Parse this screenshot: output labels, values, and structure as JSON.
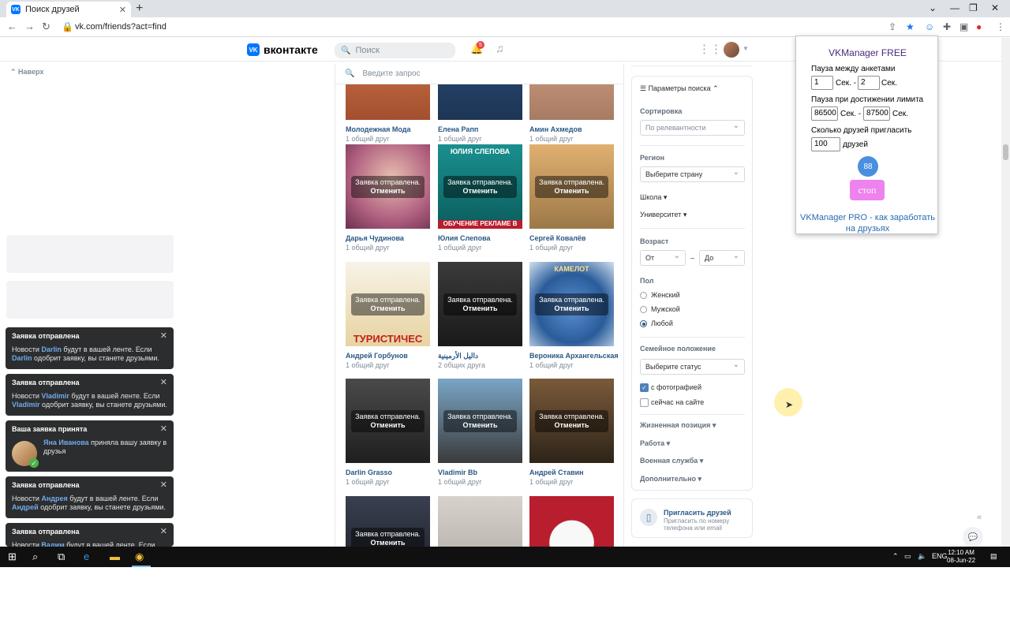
{
  "browser": {
    "tab_title": "Поиск друзей",
    "tab_favicon": "VK",
    "url": "vk.com/friends?act=find",
    "new_tab": "+",
    "back": "←",
    "forward": "→",
    "reload": "↻",
    "win_minimize": "⌄",
    "win_min": "—",
    "win_max": "❐",
    "win_close": "✕"
  },
  "header": {
    "logo_badge": "VK",
    "logo_text": "вконтакте",
    "search_placeholder": "Поиск",
    "notifications_count": "5"
  },
  "left": {
    "up_link": "Наверх"
  },
  "notifications": [
    {
      "title": "Заявка отправлена",
      "pre": "Новости ",
      "name": "Darlin",
      "mid": " будут в вашей ленте. Если ",
      "name2": "Darlin",
      "post": " одобрит заявку, вы станете друзьями."
    },
    {
      "title": "Заявка отправлена",
      "pre": "Новости ",
      "name": "Vladimir",
      "mid": " будут в вашей ленте. Если ",
      "name2": "Vladimir",
      "post": " одобрит заявку, вы станете друзьями."
    },
    {
      "title": "Ваша заявка принята",
      "name": "Яна Иванова",
      "post": " приняла вашу заявку в друзья"
    },
    {
      "title": "Заявка отправлена",
      "pre": "Новости ",
      "name": "Андрея",
      "mid": " будут в вашей ленте. Если ",
      "name2": "Андрей",
      "post": " одобрит заявку, вы станете друзьями."
    },
    {
      "title": "Заявка отправлена",
      "pre": "Новости ",
      "name": "Вадим",
      "mid": " будут в вашей ленте. Если ",
      "name2": "Вадим",
      "post": ""
    }
  ],
  "search": {
    "placeholder": "Введите запрос"
  },
  "overlay": {
    "sent": "Заявка отправлена.",
    "cancel": "Отменить"
  },
  "cards": [
    {
      "name": "Молодежная Мода",
      "mutual": "1 общий друг"
    },
    {
      "name": "Елена Рапп",
      "mutual": "1 общий друг"
    },
    {
      "name": "Амин Ахмедов",
      "mutual": "1 общий друг"
    },
    {
      "name": "Дарья Чудинова",
      "mutual": "1 общий друг"
    },
    {
      "name": "Юлия Слепова",
      "mutual": "1 общий друг",
      "poster_top": "ЮЛИЯ СЛЕПОВА",
      "poster_bottom": "ОБУЧЕНИЕ РЕКЛАМЕ В"
    },
    {
      "name": "Сергей Ковалёв",
      "mutual": "1 общий друг"
    },
    {
      "name": "Андрей Горбунов",
      "mutual": "1 общий друг",
      "poster_bottom": "ТУРИСТИЧЕС"
    },
    {
      "name": "داليل الأرمينية",
      "mutual": "2 общих друга"
    },
    {
      "name": "Вероника Архангельская",
      "mutual": "1 общий друг",
      "poster_top": "КАМЕЛОТ"
    },
    {
      "name": "Darlin Grasso",
      "mutual": "1 общий друг"
    },
    {
      "name": "Vladimir Bb",
      "mutual": "1 общий друг"
    },
    {
      "name": "Андрей Ставин",
      "mutual": "1 общий друг"
    }
  ],
  "filters": {
    "header": "Параметры поиска",
    "sort_label": "Сортировка",
    "sort_value": "По релевантности",
    "region_label": "Регион",
    "region_value": "Выберите страну",
    "school": "Школа",
    "university": "Университет",
    "age_label": "Возраст",
    "age_from": "От",
    "age_dash": "–",
    "age_to": "До",
    "gender_label": "Пол",
    "gender_options": [
      "Женский",
      "Мужской",
      "Любой"
    ],
    "gender_selected": "Любой",
    "marital_label": "Семейное положение",
    "marital_value": "Выберите статус",
    "with_photo": "с фотографией",
    "with_photo_checked": true,
    "online_now": "сейчас на сайте",
    "online_now_checked": false,
    "life_position": "Жизненная позиция",
    "work": "Работа",
    "military": "Военная служба",
    "extra": "Дополнительно"
  },
  "invite": {
    "title": "Пригласить друзей",
    "subtitle": "Пригласить по номеру телефона или email"
  },
  "extension": {
    "title": "VKManager FREE",
    "pause_label": "Пауза между анкетами",
    "pause_from": "1",
    "pause_to": "2",
    "sec": "Сек.",
    "sec_dash": "Сек. -",
    "limit_label": "Пауза при достижении лимита",
    "limit_from": "86500",
    "limit_to": "87500",
    "invite_label": "Сколько друзей пригласить",
    "invite_count": "100",
    "friends_word": "друзей",
    "counter": "88",
    "stop_label": "стоп",
    "pro_link": "VKManager PRO - как заработать на друзьях"
  },
  "taskbar": {
    "lang": "ENG",
    "time": "12:10 AM",
    "date": "08-Jun-22"
  },
  "colors": {
    "vk_blue": "#0077ff",
    "link_blue": "#2a5885",
    "notif_bg": "#2c2d2e",
    "stop_pink": "#ee82ee",
    "counter_blue": "#4a8fe0"
  }
}
